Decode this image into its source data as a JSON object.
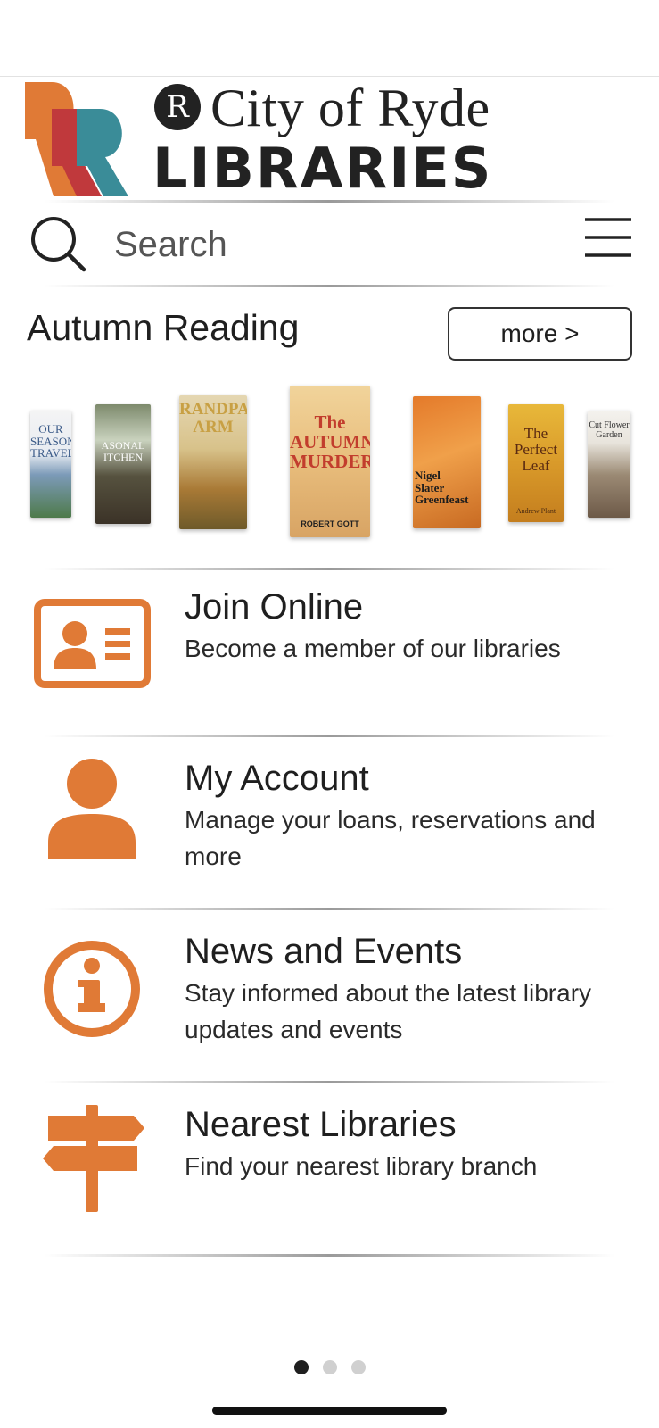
{
  "header": {
    "logo_badge_letter": "R",
    "logo_line1": "City of Ryde",
    "logo_line2": "LIBRARIES",
    "brand_colors": {
      "orange": "#E07A36",
      "red": "#C0393C",
      "teal": "#3A8C98"
    }
  },
  "search": {
    "placeholder": "Search",
    "value": ""
  },
  "featured": {
    "title": "Autumn Reading",
    "more_label": "more >",
    "books": [
      {
        "id": "travel",
        "cover_text": "OUR SEASONS\nTRAVEL"
      },
      {
        "id": "kitchen",
        "cover_text": "ASONAL\nITCHEN"
      },
      {
        "id": "farm",
        "cover_text": "RANDPA\nARM"
      },
      {
        "id": "autumn-murders",
        "cover_text": "The\nAUTUMN\nMURDERS",
        "author": "ROBERT GOTT"
      },
      {
        "id": "greenfeast",
        "cover_text": "Nigel\nSlater\nGreenfeast"
      },
      {
        "id": "perfect-leaf",
        "cover_text": "The\nPerfect\nLeaf",
        "author": "Andrew Plant"
      },
      {
        "id": "cut-flower",
        "cover_text": "Cut Flower\nGarden"
      }
    ]
  },
  "menu": {
    "items": [
      {
        "key": "join",
        "icon": "id-card-icon",
        "title": "Join Online",
        "subtitle": "Become a member of our libraries"
      },
      {
        "key": "account",
        "icon": "user-icon",
        "title": "My Account",
        "subtitle": "Manage your loans, reservations and more"
      },
      {
        "key": "news",
        "icon": "info-icon",
        "title": "News and Events",
        "subtitle": "Stay informed about the latest library updates and events"
      },
      {
        "key": "nearest",
        "icon": "signpost-icon",
        "title": "Nearest Libraries",
        "subtitle": "Find your nearest library branch"
      }
    ]
  },
  "pagination": {
    "current": 1,
    "total": 3
  },
  "colors": {
    "accent": "#E07A36",
    "text": "#1F1F1F"
  }
}
